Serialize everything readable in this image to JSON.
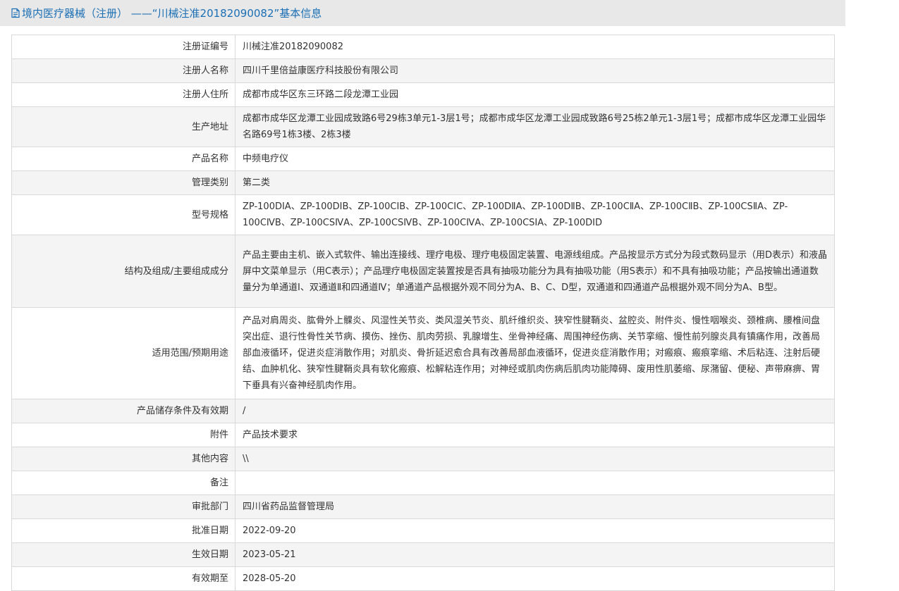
{
  "header": {
    "title": "境内医疗器械（注册） ——“川械注准20182090082”基本信息",
    "icon": "document-icon",
    "accent": "#1a6fb5"
  },
  "rows": [
    {
      "label": "注册证编号",
      "value": "川械注准20182090082"
    },
    {
      "label": "注册人名称",
      "value": "四川千里倍益康医疗科技股份有限公司"
    },
    {
      "label": "注册人住所",
      "value": "成都市成华区东三环路二段龙潭工业园"
    },
    {
      "label": "生产地址",
      "value": "成都市成华区龙潭工业园成致路6号29栋3单元1-3层1号；成都市成华区龙潭工业园成致路6号25栋2单元1-3层1号；成都市成华区龙潭工业园华名路69号1栋3楼、2栋3楼"
    },
    {
      "label": "产品名称",
      "value": "中频电疗仪"
    },
    {
      "label": "管理类别",
      "value": "第二类"
    },
    {
      "label": "型号规格",
      "value": "ZP-100DⅠA、ZP-100DⅠB、ZP-100CⅠB、ZP-100CⅠC、ZP-100DⅡA、ZP-100DⅡB、ZP-100CⅡA、ZP-100CⅡB、ZP-100CSⅡA、ZP-100CⅣB、ZP-100CSⅣA、ZP-100CSⅣB、ZP-100CⅣA、ZP-100CSⅠA、ZP-100DⅠD"
    },
    {
      "label": "结构及组成/主要组成成分",
      "value": "产品主要由主机、嵌入式软件、输出连接线、理疗电极、理疗电极固定装置、电源线组成。产品按显示方式分为段式数码显示（用D表示）和液晶屏中文菜单显示（用C表示）；产品理疗电极固定装置按是否具有抽吸功能分为具有抽吸功能（用S表示）和不具有抽吸功能；产品按输出通道数量分为单通道Ⅰ、双通道Ⅱ和四通道Ⅳ；单通道产品根据外观不同分为A、B、C、D型，双通道和四通道产品根据外观不同分为A、B型。"
    },
    {
      "label": "适用范围/预期用途",
      "value": "产品对肩周炎、肱骨外上髁炎、风湿性关节炎、类风湿关节炎、肌纤维织炎、狭窄性腱鞘炎、盆腔炎、附件炎、慢性咽喉炎、颈椎病、腰椎间盘突出症、退行性骨性关节病、摸伤、挫伤、肌肉劳损、乳腺增生、坐骨神经痛、周围神经伤病、关节挛缩、慢性前列腺炎具有镇痛作用，改善局部血液循环，促进炎症消散作用；对肌炎、骨折延迟愈合具有改善局部血液循环，促进炎症消散作用；对瘢痕、瘢痕挛缩、术后粘连、注射后硬结、血肿机化、狭窄性腱鞘炎具有软化瘢痕、松解粘连作用；对神经或肌肉伤病后肌肉功能障碍、废用性肌萎缩、尿潴留、便秘、声带麻痹、胃下垂具有兴奋神经肌肉作用。"
    },
    {
      "label": "产品储存条件及有效期",
      "value": "/"
    },
    {
      "label": "附件",
      "value": "产品技术要求"
    },
    {
      "label": "其他内容",
      "value": "\\\\"
    },
    {
      "label": "备注",
      "value": ""
    },
    {
      "label": "审批部门",
      "value": "四川省药品监督管理局"
    },
    {
      "label": "批准日期",
      "value": "2022-09-20"
    },
    {
      "label": "生效日期",
      "value": "2023-05-21"
    },
    {
      "label": "有效期至",
      "value": "2028-05-20"
    }
  ]
}
